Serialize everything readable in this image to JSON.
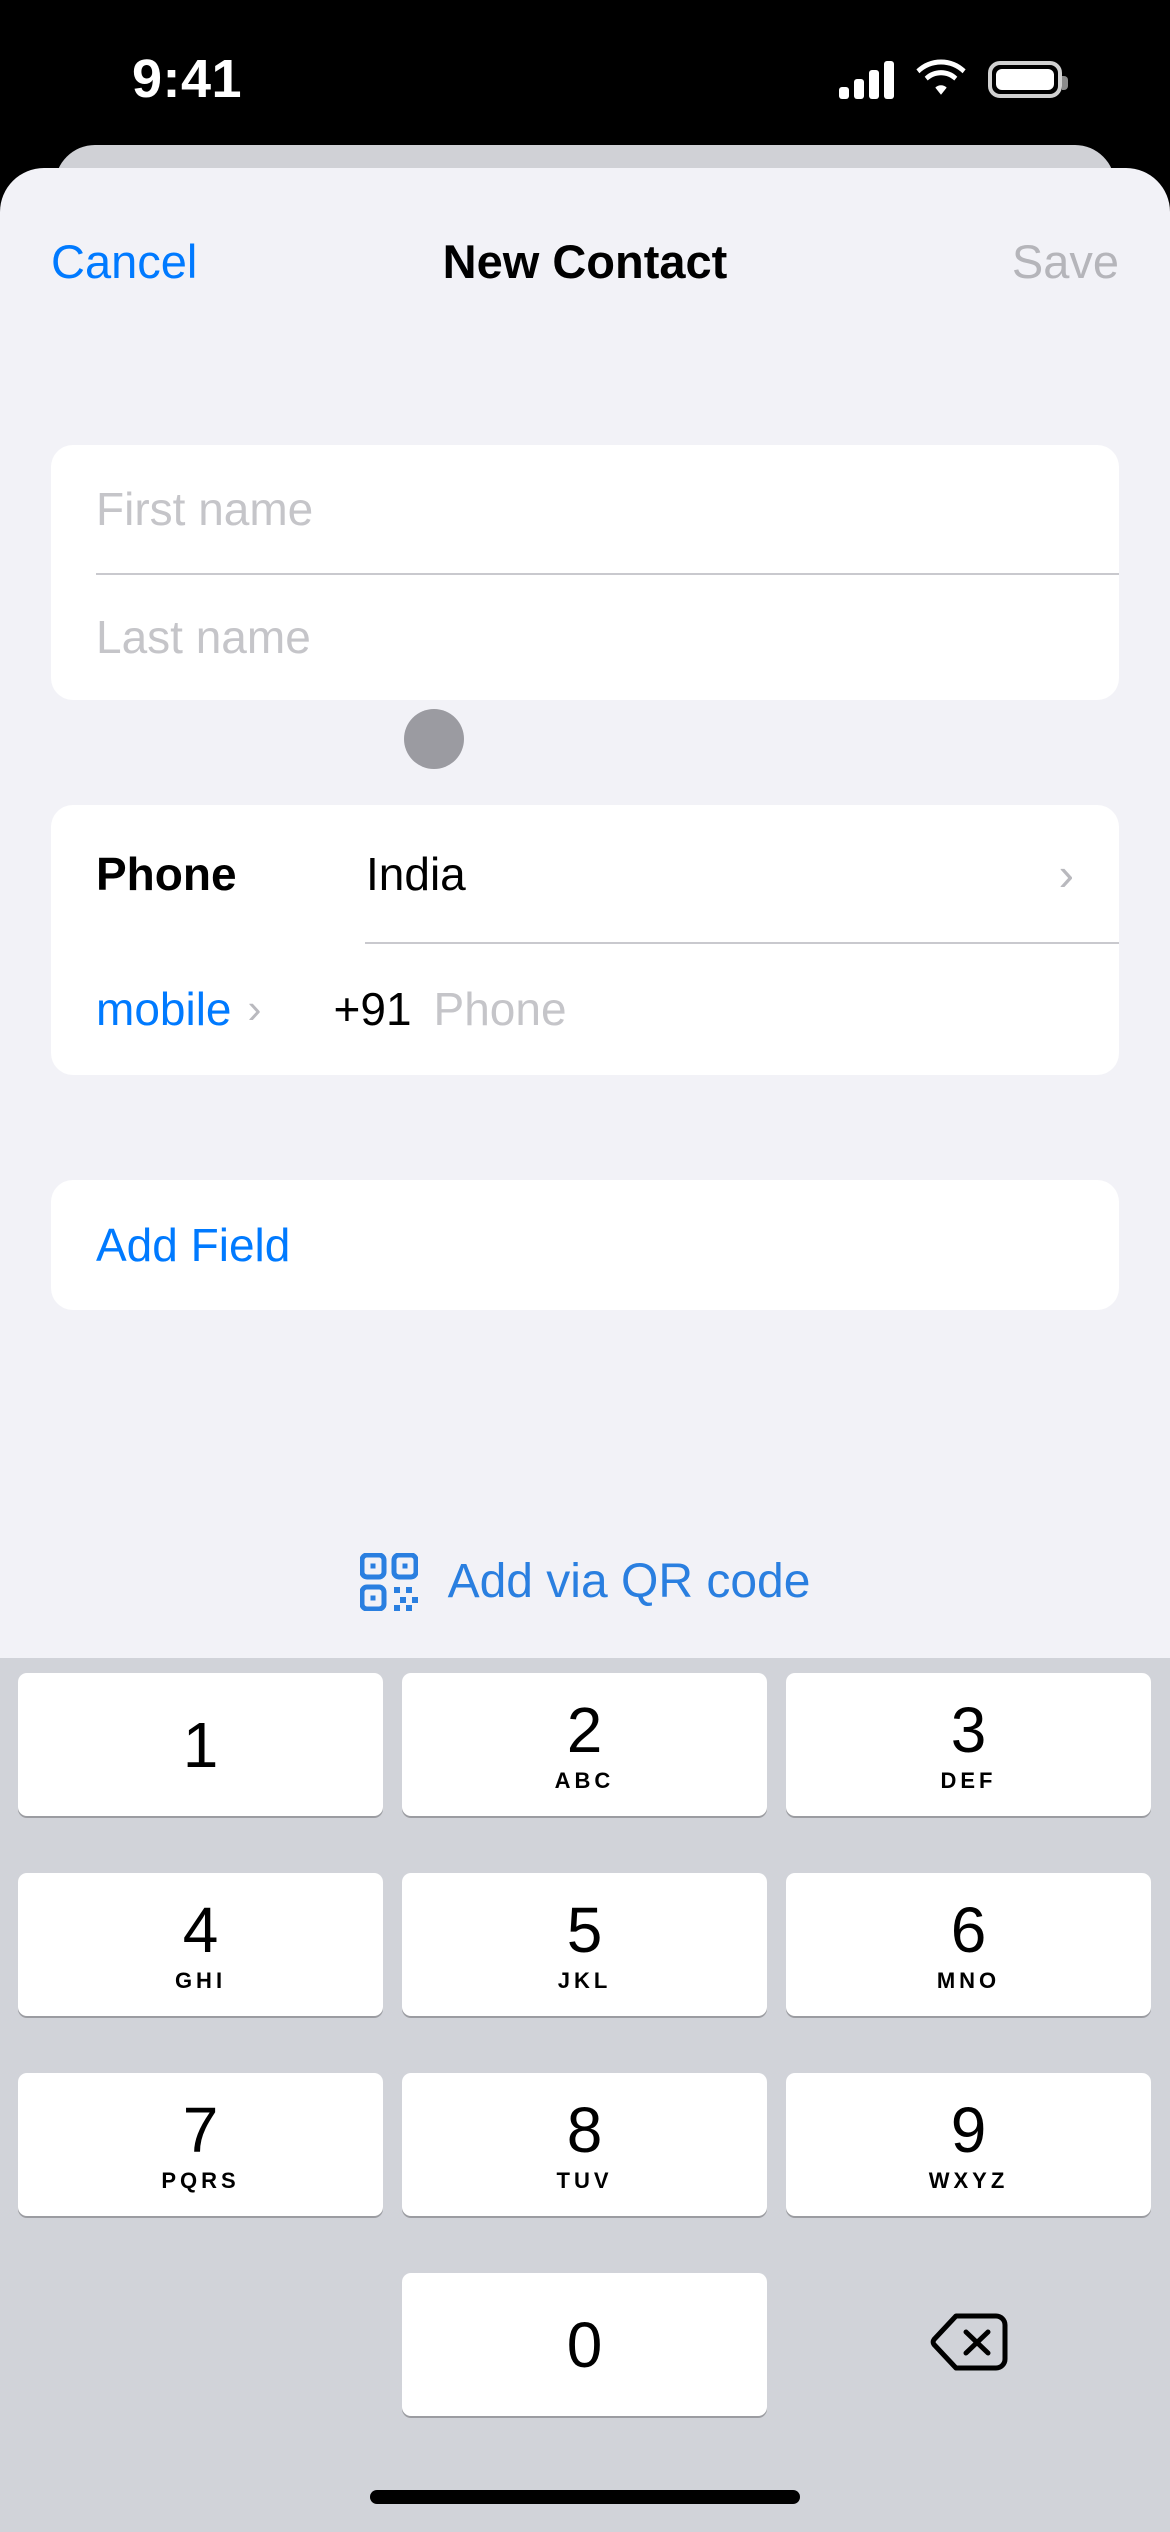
{
  "status_bar": {
    "time": "9:41",
    "cellular_icon": "cellular-signal-icon",
    "wifi_icon": "wifi-icon",
    "battery_icon": "battery-icon"
  },
  "nav": {
    "cancel_label": "Cancel",
    "title": "New Contact",
    "save_label": "Save"
  },
  "name_section": {
    "first_name_value": "",
    "first_name_placeholder": "First name",
    "last_name_value": "",
    "last_name_placeholder": "Last name"
  },
  "phone_section": {
    "phone_label": "Phone",
    "country_value": "India",
    "country_chevron": "›",
    "type_label": "mobile",
    "type_chevron": "›",
    "country_code": "+91",
    "number_value": "",
    "number_placeholder": "Phone"
  },
  "add_field": {
    "label": "Add Field"
  },
  "qr": {
    "label": "Add via QR code",
    "icon": "qr-code-icon"
  },
  "keypad": {
    "keys": [
      {
        "digit": "1",
        "letters": ""
      },
      {
        "digit": "2",
        "letters": "ABC"
      },
      {
        "digit": "3",
        "letters": "DEF"
      },
      {
        "digit": "4",
        "letters": "GHI"
      },
      {
        "digit": "5",
        "letters": "JKL"
      },
      {
        "digit": "6",
        "letters": "MNO"
      },
      {
        "digit": "7",
        "letters": "PQRS"
      },
      {
        "digit": "8",
        "letters": "TUV"
      },
      {
        "digit": "9",
        "letters": "WXYZ"
      },
      {
        "digit": "0",
        "letters": ""
      }
    ],
    "delete_icon": "backspace-delete-icon"
  },
  "colors": {
    "accent_blue": "#007aff",
    "qr_blue": "#2a7fe0",
    "disabled_grey": "#b5b5ba",
    "placeholder_grey": "#c5c5c9",
    "sheet_background": "#f2f2f7",
    "card_background": "#ffffff",
    "keyboard_background": "#d1d3d9",
    "avatar_dot": "#9b9ba1"
  }
}
